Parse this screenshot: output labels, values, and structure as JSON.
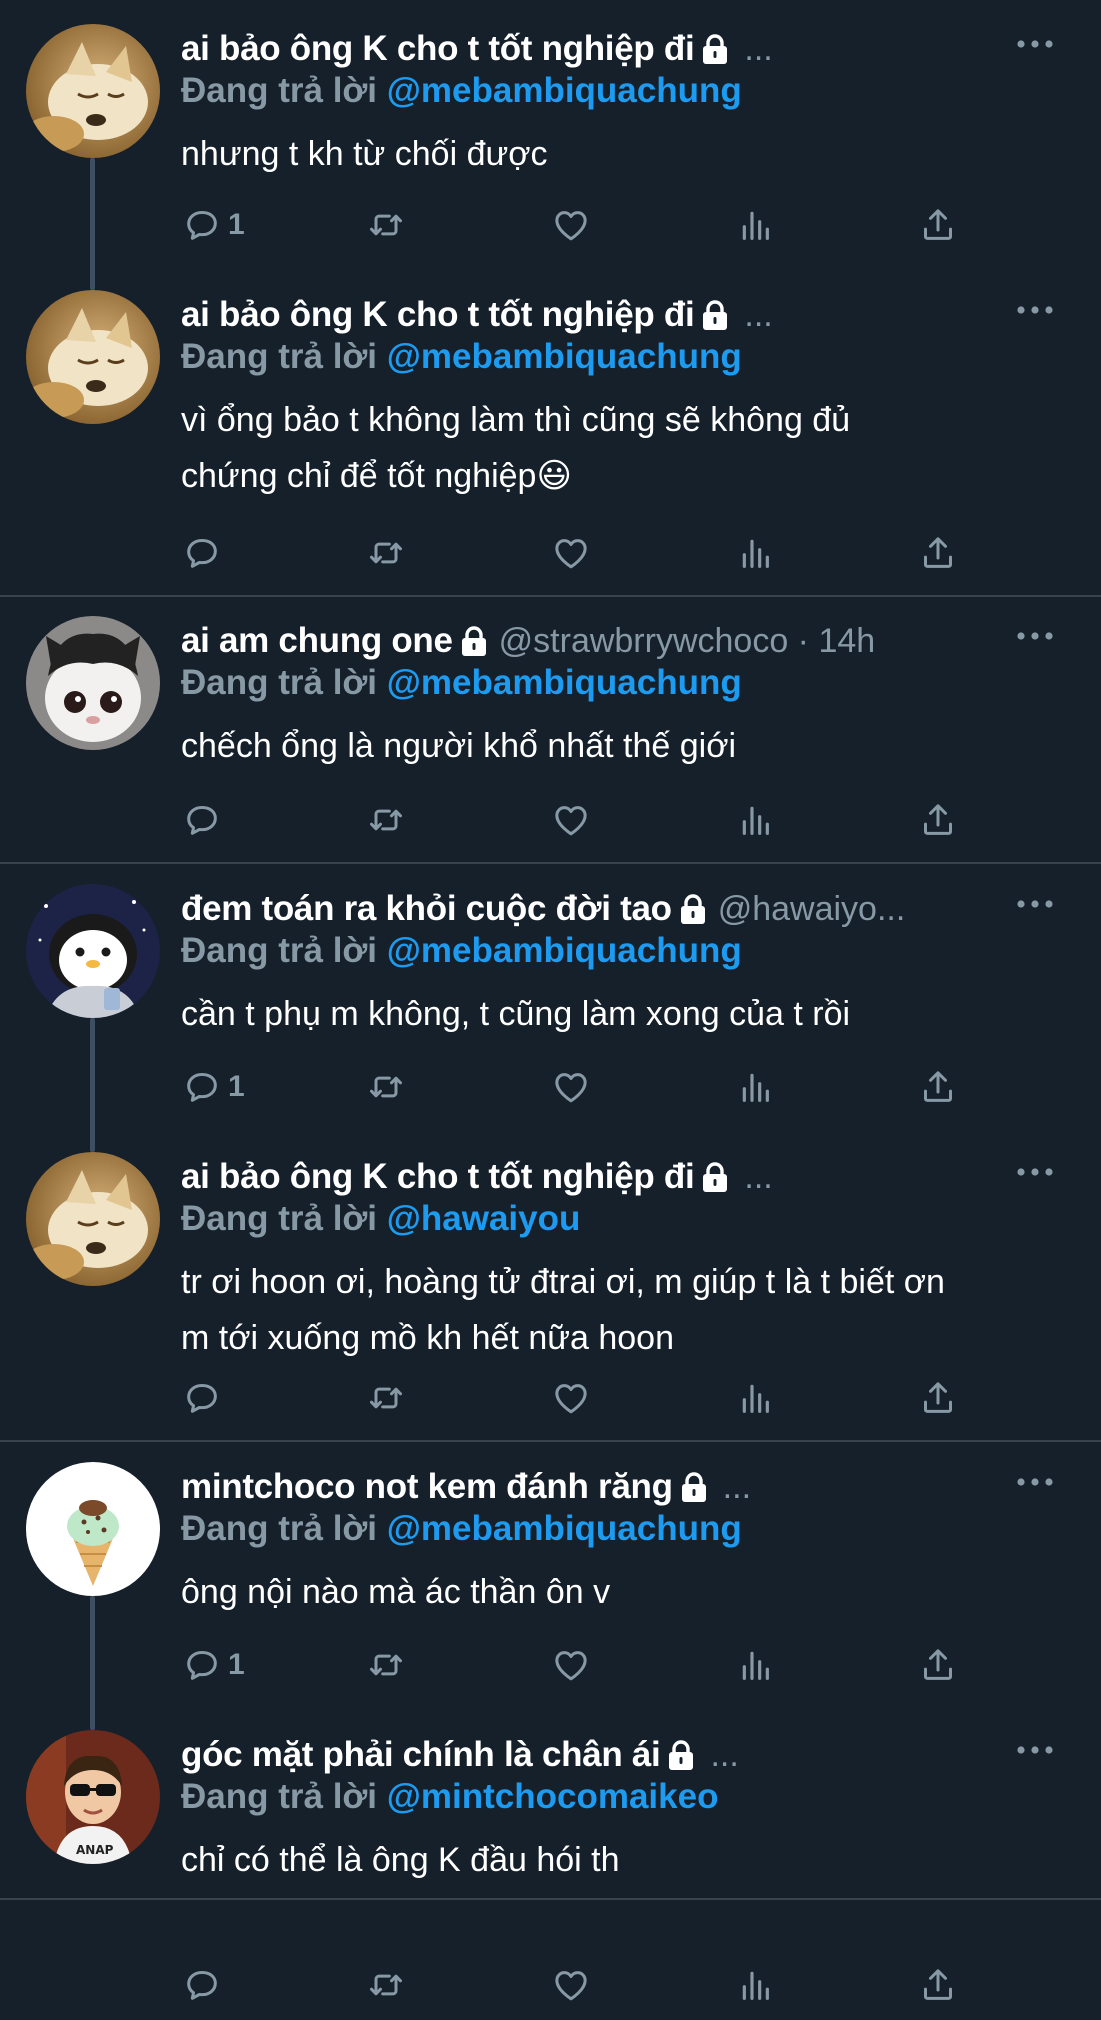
{
  "colors": {
    "background": "#15202b",
    "accent": "#1d9bf0",
    "muted": "#8899a6",
    "divider": "#38444d"
  },
  "icons": [
    "reply-icon",
    "retweet-icon",
    "like-icon",
    "views-icon",
    "share-icon",
    "lock-icon",
    "more-icon"
  ],
  "tweets": [
    {
      "name": "ai bảo ông K cho t tốt nghiệp đi",
      "handle": "...",
      "reply_prefix": "Đang trả lời",
      "mention": "@mebambiquachung",
      "lines": [
        "nhưng t kh từ chối được"
      ],
      "reply_count": "1",
      "avatar": "dog"
    },
    {
      "name": "ai bảo ông K cho t tốt nghiệp đi",
      "handle": "...",
      "reply_prefix": "Đang trả lời",
      "mention": "@mebambiquachung",
      "lines": [
        "vì ổng bảo t không làm thì cũng sẽ không đủ",
        "chứng chỉ để tốt nghiệp😃"
      ],
      "reply_count": "",
      "avatar": "dog"
    },
    {
      "name": "ai am chung one",
      "handle": "@strawbrrywchoco · 14h",
      "reply_prefix": "Đang trả lời",
      "mention": "@mebambiquachung",
      "lines": [
        "chếch ổng là người khổ nhất thế giới"
      ],
      "reply_count": "",
      "avatar": "cat"
    },
    {
      "name": "đem toán ra khỏi cuộc đời tao",
      "handle": "@hawaiyo...",
      "reply_prefix": "Đang trả lời",
      "mention": "@mebambiquachung",
      "lines": [
        "cần t phụ m không, t cũng làm xong của t rồi"
      ],
      "reply_count": "1",
      "avatar": "penguin"
    },
    {
      "name": "ai bảo ông K cho t tốt nghiệp đi",
      "handle": "...",
      "reply_prefix": "Đang trả lời",
      "mention": "@hawaiyou",
      "lines": [
        "tr ơi hoon ơi, hoàng tử đtrai ơi, m giúp t là t biết ơn",
        "m tới xuống mồ kh hết nữa hoon"
      ],
      "reply_count": "",
      "avatar": "dog"
    },
    {
      "name": "mintchoco not kem đánh răng",
      "handle": "...",
      "reply_prefix": "Đang trả lời",
      "mention": "@mebambiquachung",
      "lines": [
        "ông nội nào mà ác thần ôn v"
      ],
      "reply_count": "1",
      "avatar": "icecream"
    },
    {
      "name": "góc mặt phải chính là chân ái",
      "handle": "...",
      "reply_prefix": "Đang trả lời",
      "mention": "@mintchocomaikeo",
      "lines": [
        "chỉ có thể là ông K đầu hói th"
      ],
      "reply_count": "",
      "avatar": "kid"
    }
  ]
}
